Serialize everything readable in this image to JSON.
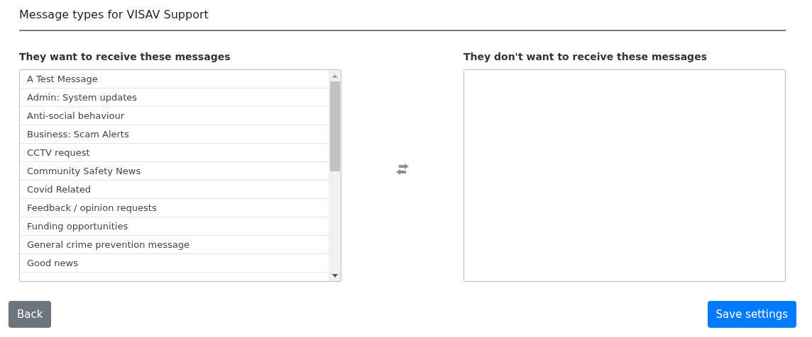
{
  "title": "Message types for VISAV Support",
  "receive": {
    "heading": "They want to receive these messages",
    "items": [
      {
        "label": "A Test Message"
      },
      {
        "label": "Admin: System updates"
      },
      {
        "label": "Anti-social behaviour"
      },
      {
        "label": "Business: Scam Alerts"
      },
      {
        "label": "CCTV request"
      },
      {
        "label": "Community Safety News"
      },
      {
        "label": "Covid Related"
      },
      {
        "label": "Feedback / opinion requests"
      },
      {
        "label": "Funding opportunities"
      },
      {
        "label": "General crime prevention message"
      },
      {
        "label": "Good news"
      }
    ]
  },
  "not_receive": {
    "heading": "They don't want to receive these messages"
  },
  "buttons": {
    "back": "Back",
    "save": "Save settings"
  }
}
